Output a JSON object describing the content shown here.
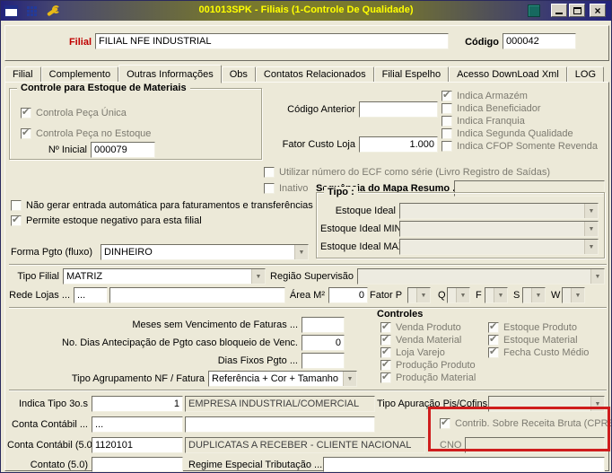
{
  "window": {
    "title": "001013SPK - Filiais (1-Controle De Qualidade)"
  },
  "colors": {
    "title_text": "#ffff00",
    "filial_label": "#c00000",
    "annotation_box": "#cf1d1d"
  },
  "icons": {
    "combo_arrow": "▼",
    "close_glyph": "×"
  },
  "header": {
    "filial_label": "Filial",
    "filial_value": "FILIAL NFE INDUSTRIAL",
    "codigo_label": "Código",
    "codigo_value": "000042"
  },
  "tabs": [
    {
      "label": "Filial",
      "active": false
    },
    {
      "label": "Complemento",
      "active": false
    },
    {
      "label": "Outras Informações",
      "active": true
    },
    {
      "label": "Obs",
      "active": false
    },
    {
      "label": "Contatos Relacionados",
      "active": false
    },
    {
      "label": "Filial Espelho",
      "active": false
    },
    {
      "label": "Acesso DownLoad Xml",
      "active": false
    },
    {
      "label": "LOG",
      "active": false
    }
  ],
  "estoque_group": {
    "title": "Controle para Estoque de Materiais",
    "controla_peca_unica": {
      "label": "Controla Peça Única",
      "checked": true
    },
    "controla_peca_estoque": {
      "label": "Controla Peça no Estoque",
      "checked": true
    },
    "no_inicial": {
      "label": "Nº Inicial",
      "value": "000079"
    }
  },
  "codigo_anterior": {
    "label": "Código Anterior",
    "value": ""
  },
  "fator_custo_loja": {
    "label": "Fator Custo Loja",
    "value": "1.000"
  },
  "indica_checks": [
    {
      "label": "Indica Armazém",
      "checked": true
    },
    {
      "label": "Indica Beneficiador",
      "checked": false
    },
    {
      "label": "Indica Franquia",
      "checked": false
    },
    {
      "label": "Indica Segunda Qualidade",
      "checked": false
    },
    {
      "label": "Indica CFOP Somente Revenda",
      "checked": false
    }
  ],
  "ecf_check": {
    "label": "Utilizar número do ECF como série (Livro Registro de Saídas)",
    "checked": false
  },
  "inativo_check": {
    "label": "Inativo",
    "checked": false
  },
  "mapa_resumo": {
    "label": "Sequência do Mapa Resumo ...",
    "value": ""
  },
  "nao_gerar_check": {
    "label": "Não gerar entrada automática para faturamentos e transferências",
    "checked": false
  },
  "estoque_negativo_check": {
    "label": "Permite estoque negativo para esta filial",
    "checked": true
  },
  "tipo_group": {
    "title": "Tipo :",
    "estoque_ideal": {
      "label": "Estoque Ideal",
      "value": ""
    },
    "estoque_ideal_min": {
      "label": "Estoque Ideal MIN",
      "value": ""
    },
    "estoque_ideal_max": {
      "label": "Estoque Ideal MAX",
      "value": ""
    }
  },
  "forma_pgto": {
    "label": "Forma Pgto (fluxo)",
    "value": "DINHEIRO"
  },
  "tipo_filial": {
    "label": "Tipo Filial",
    "value": "MATRIZ"
  },
  "regiao_supervisao": {
    "label": "Região Supervisão",
    "value": ""
  },
  "rede_lojas": {
    "label": "Rede Lojas ...",
    "code": "...",
    "descr": ""
  },
  "area_m2": {
    "label": "Área M²",
    "value": "0"
  },
  "fatores": {
    "p": {
      "label": "Fator P",
      "value": ""
    },
    "q": {
      "label": "Q",
      "value": ""
    },
    "f": {
      "label": "F",
      "value": ""
    },
    "s": {
      "label": "S",
      "value": ""
    },
    "w": {
      "label": "W",
      "value": ""
    }
  },
  "meses_sem_vencimento": {
    "label": "Meses sem Vencimento de Faturas ...",
    "value": ""
  },
  "dias_antecipacao": {
    "label": "No. Dias Antecipação de Pgto caso bloqueio de Venc.",
    "value": "0"
  },
  "dias_fixos_pgto": {
    "label": "Dias Fixos Pgto ...",
    "value": ""
  },
  "tipo_agrupamento": {
    "label": "Tipo Agrupamento NF / Fatura",
    "value": "Referência + Cor + Tamanho"
  },
  "controles_group": {
    "title": "Controles",
    "col1": [
      {
        "label": "Venda Produto",
        "checked": true
      },
      {
        "label": "Venda Material",
        "checked": true
      },
      {
        "label": "Loja Varejo",
        "checked": true
      },
      {
        "label": "Produção Produto",
        "checked": true
      },
      {
        "label": "Produção Material",
        "checked": true
      }
    ],
    "col2": [
      {
        "label": "Estoque Produto",
        "checked": true
      },
      {
        "label": "Estoque Material",
        "checked": true
      },
      {
        "label": "Fecha Custo Médio",
        "checked": true
      }
    ]
  },
  "indica_tipo_3os": {
    "label": "Indica Tipo 3o.s",
    "value": "1",
    "descr": "EMPRESA INDUSTRIAL/COMERCIAL"
  },
  "tipo_apuracao": {
    "label": "Tipo Apuração Pis/Cofins",
    "value": ""
  },
  "conta_contabil": {
    "label": "Conta Contábil ...",
    "code": "...",
    "descr": ""
  },
  "cprb_check": {
    "label": "Contrib. Sobre Receita Bruta (CPRB)",
    "checked": true
  },
  "conta_contabil_50": {
    "label": "Conta Contábil (5.0)",
    "code": "1120101",
    "descr": "DUPLICATAS A RECEBER - CLIENTE NACIONAL"
  },
  "cno": {
    "label": "CNO",
    "value": ""
  },
  "contato_50": {
    "label": "Contato (5.0)",
    "value": ""
  },
  "regime_especial": {
    "label": "Regime Especial Tributação ...",
    "value": ""
  }
}
